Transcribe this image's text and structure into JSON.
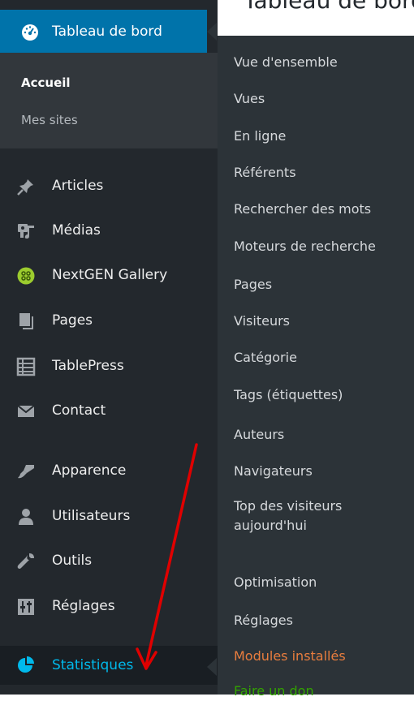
{
  "page": {
    "title": "Tableau de bord"
  },
  "sidebar": {
    "top": {
      "label": "Tableau de bord",
      "icon": "dashboard-icon"
    },
    "sub": [
      {
        "label": "Accueil",
        "current": true
      },
      {
        "label": "Mes sites",
        "current": false
      }
    ],
    "items": [
      {
        "label": "Articles",
        "icon": "pin-icon"
      },
      {
        "label": "Médias",
        "icon": "media-icon"
      },
      {
        "label": "NextGEN Gallery",
        "icon": "nextgen-gallery-icon"
      },
      {
        "label": "Pages",
        "icon": "pages-icon"
      },
      {
        "label": "TablePress",
        "icon": "table-icon"
      },
      {
        "label": "Contact",
        "icon": "envelope-icon"
      },
      {
        "label": "Apparence",
        "icon": "brush-icon"
      },
      {
        "label": "Utilisateurs",
        "icon": "users-icon"
      },
      {
        "label": "Outils",
        "icon": "wrench-icon"
      },
      {
        "label": "Réglages",
        "icon": "settings-sliders-icon"
      },
      {
        "label": "Statistiques",
        "icon": "pie-chart-icon",
        "active": true
      }
    ]
  },
  "flyout": {
    "items": [
      "Vue d'ensemble",
      "Vues",
      "En ligne",
      "Référents",
      "Rechercher des mots",
      "Moteurs de recherche",
      "Pages",
      "Visiteurs",
      "Catégorie",
      "Tags (étiquettes)",
      "Auteurs",
      "Navigateurs",
      "Top des visiteurs",
      "aujourd'hui",
      "Optimisation",
      "Réglages",
      "Modules installés",
      "Faire un don"
    ]
  },
  "colors": {
    "sidebar_bg": "#23282d",
    "active_blue": "#0073aa",
    "flyout_bg": "#2c3338",
    "highlight_cyan": "#00b9eb",
    "orange_link": "#e87d3e",
    "green_link": "#32a300",
    "annotation_arrow": "#e00000"
  }
}
